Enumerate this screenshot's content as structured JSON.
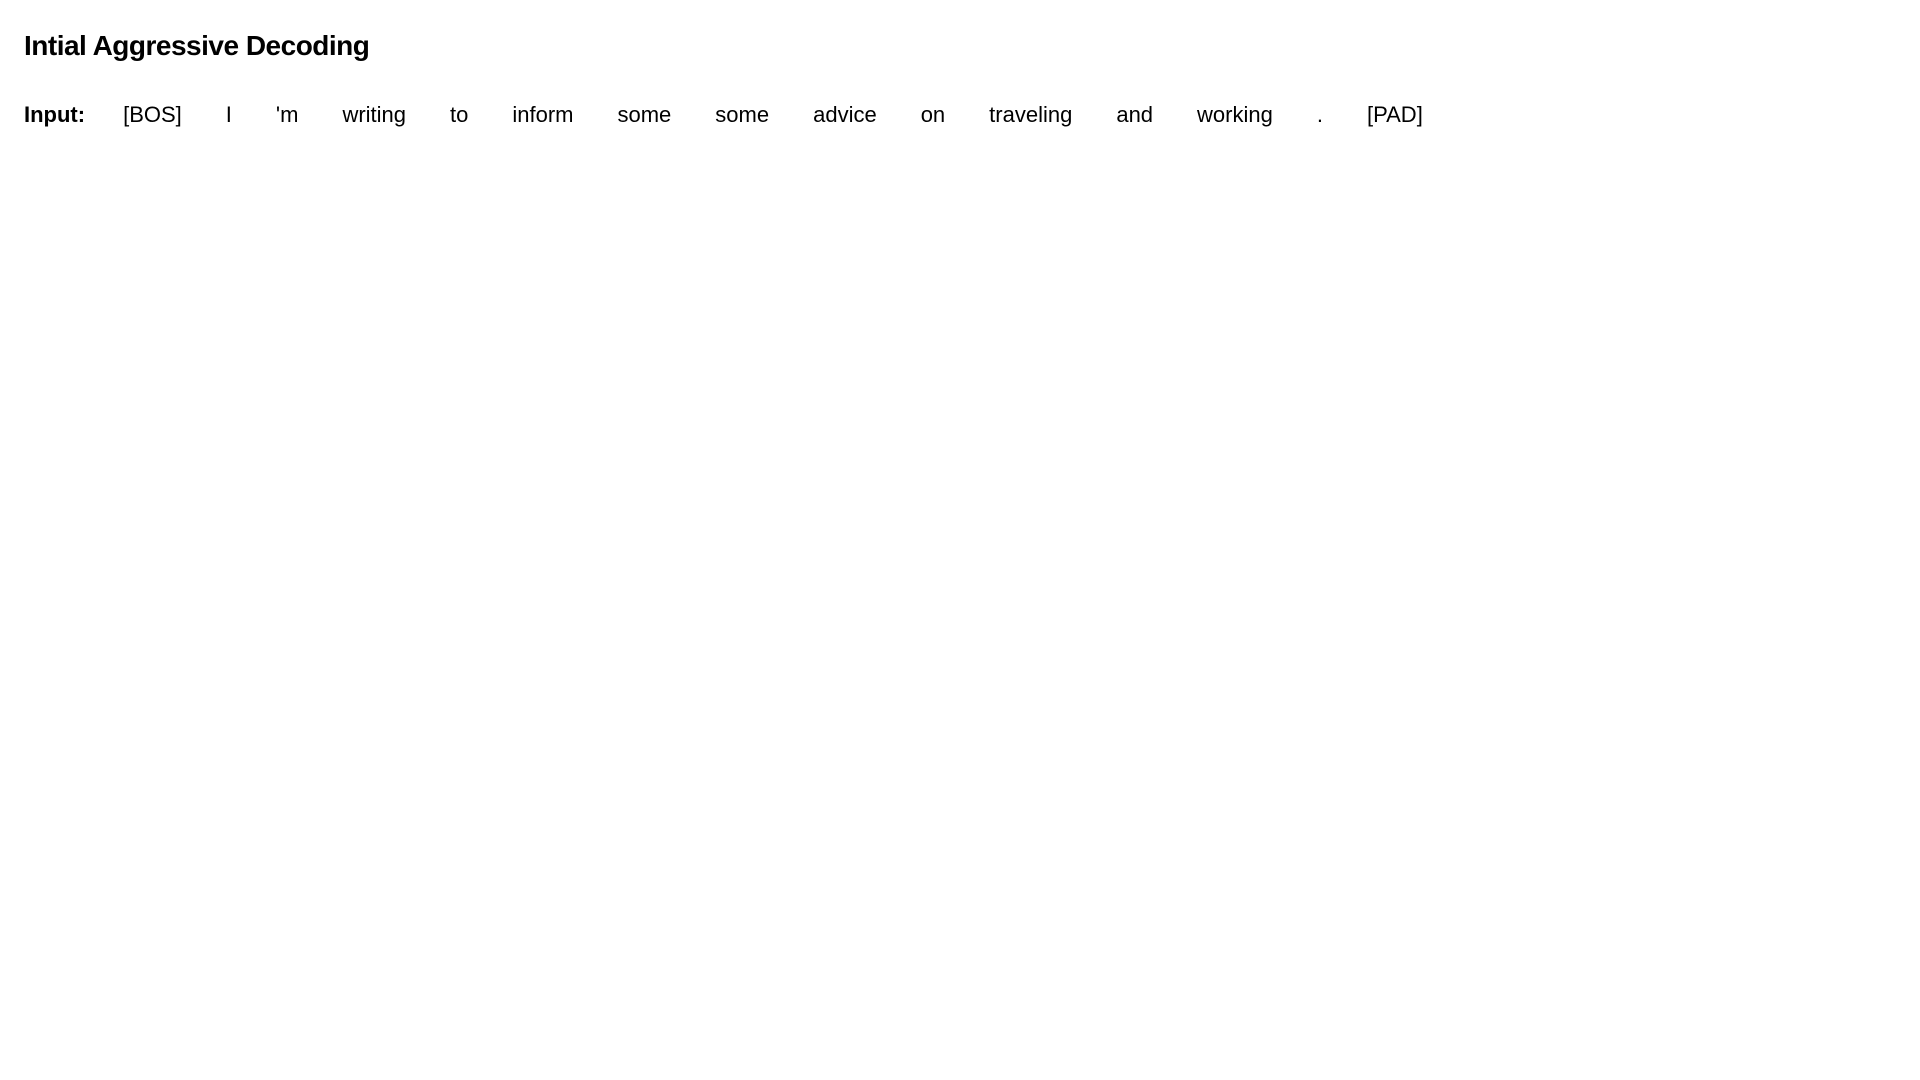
{
  "page": {
    "title": "Intial Aggressive Decoding"
  },
  "input": {
    "label": "Input:",
    "tokens": [
      "[BOS]",
      "I",
      "'m",
      "writing",
      "to",
      "inform",
      "some",
      "some",
      "advice",
      "on",
      "traveling",
      "and",
      "working",
      ".",
      "[PAD]"
    ]
  }
}
